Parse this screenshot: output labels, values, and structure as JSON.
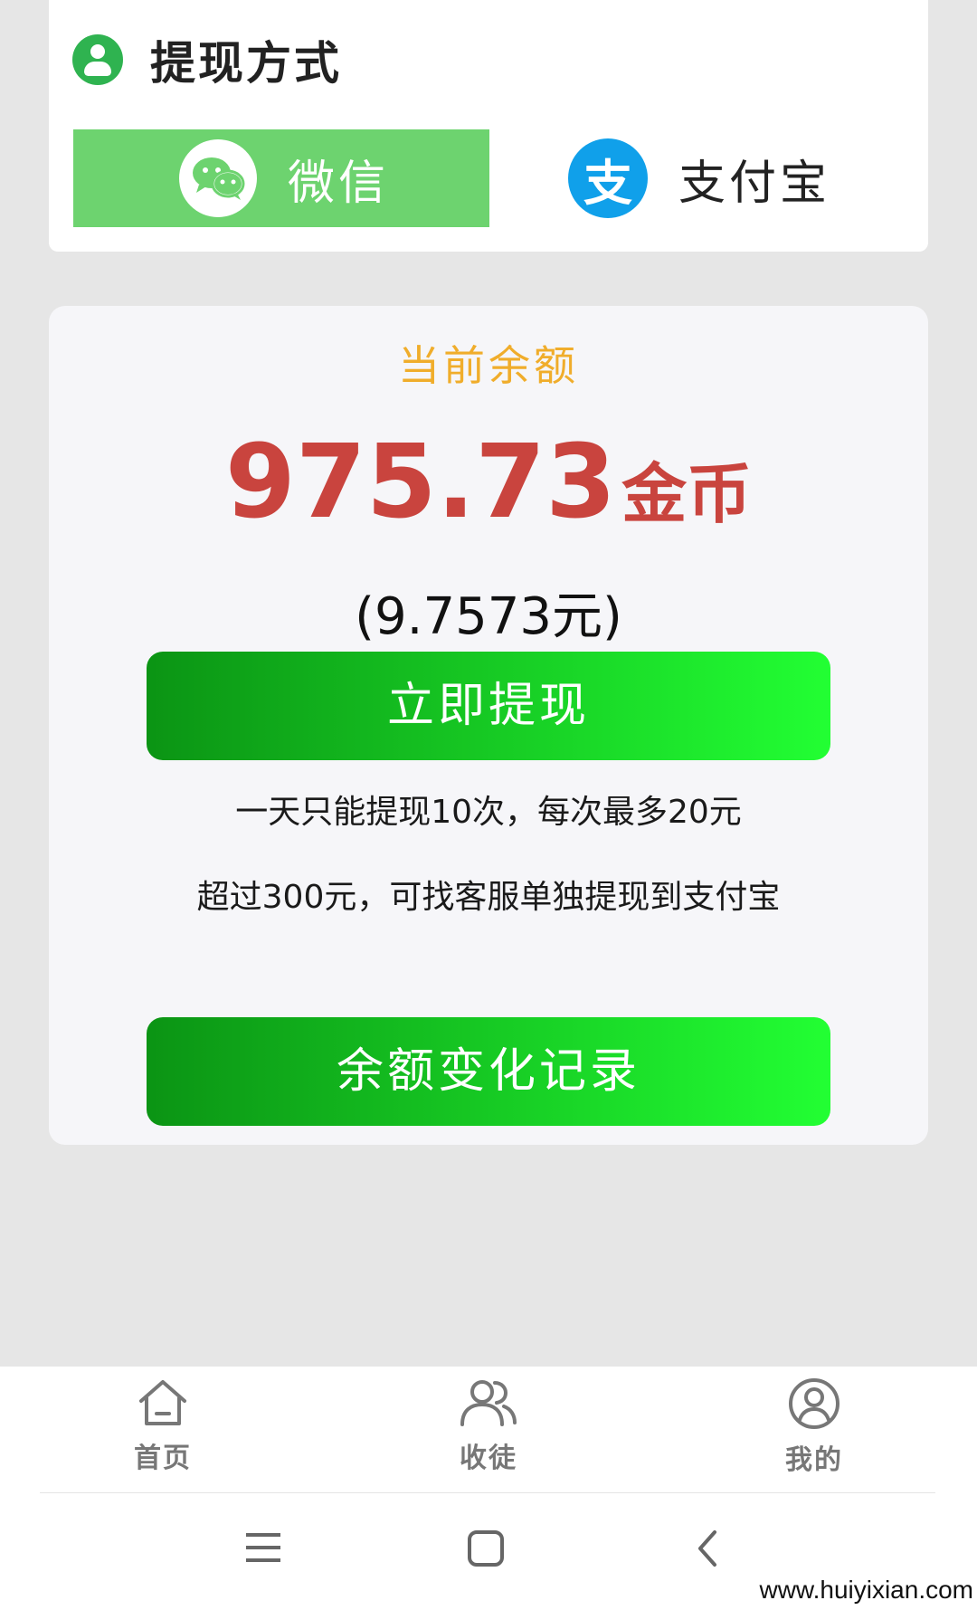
{
  "withdraw_method": {
    "title": "提现方式",
    "options": [
      {
        "label": "微信",
        "selected": true,
        "icon": "wechat-icon"
      },
      {
        "label": "支付宝",
        "selected": false,
        "icon": "alipay-icon"
      }
    ],
    "alipay_glyph": "支"
  },
  "balance": {
    "label": "当前余额",
    "amount": "975.73",
    "unit": "金币",
    "yuan": "(9.7573元)",
    "withdraw_button": "立即提现",
    "rule_1": "一天只能提现10次，每次最多20元",
    "rule_2": "超过300元，可找客服单独提现到支付宝",
    "history_button": "余额变化记录"
  },
  "tabbar": {
    "items": [
      {
        "label": "首页",
        "icon": "home-icon"
      },
      {
        "label": "收徒",
        "icon": "users-icon"
      },
      {
        "label": "我的",
        "icon": "profile-icon"
      }
    ]
  },
  "colors": {
    "accent_green": "#22c32f",
    "amount_red": "#c9443e",
    "label_orange": "#f0ad2b",
    "alipay_blue": "#10a0ea"
  },
  "watermark": "www.huiyixian.com"
}
